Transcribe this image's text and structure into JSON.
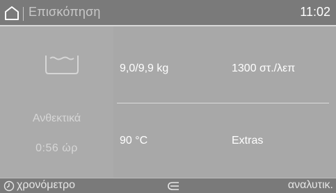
{
  "header": {
    "icon": "home-icon",
    "title": "Επισκόπηση",
    "time": "11:02"
  },
  "program": {
    "icon": "washing-tub-icon",
    "name": "Ανθεκτικά",
    "duration": "0:56 ώρ"
  },
  "settings": {
    "load": "9,0/9,9 kg",
    "spin": "1300 στ./λεπ",
    "temperature": "90 °C",
    "extras": "Extras"
  },
  "footer": {
    "timer_icon": "clock-icon",
    "timer_label": "χρονόμετρο",
    "eco_icon": "eco-feedback-icon",
    "details_label": "αναλυτικ."
  },
  "colors": {
    "background": "#a9a9a9",
    "bar": "#7a7a7a",
    "text": "#ffffff",
    "dim_text": "#d6d6d6"
  }
}
